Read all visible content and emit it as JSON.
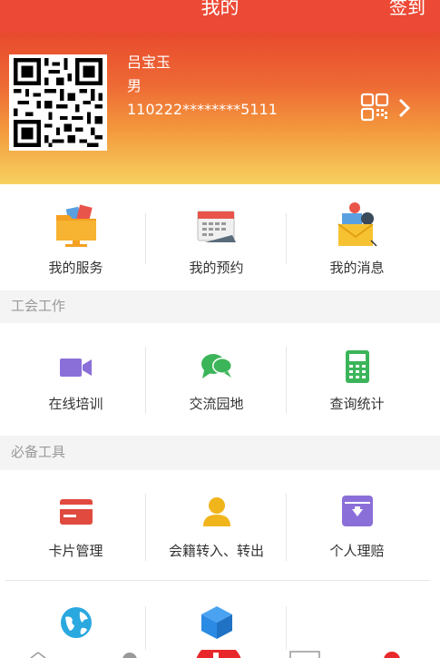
{
  "header": {
    "title": "我的",
    "action_label": "签到"
  },
  "profile": {
    "name": "吕宝玉",
    "gender": "男",
    "id_number": "110222********5111"
  },
  "quick_actions": [
    {
      "label": "我的服务",
      "icon": "folder-icon"
    },
    {
      "label": "我的预约",
      "icon": "calendar-icon"
    },
    {
      "label": "我的消息",
      "icon": "envelope-icon"
    }
  ],
  "section_union": {
    "title": "工会工作",
    "items": [
      {
        "label": "在线培训",
        "icon": "video-camera-icon",
        "color": "#8b6fd9"
      },
      {
        "label": "交流园地",
        "icon": "chat-bubbles-icon",
        "color": "#3cb55a"
      },
      {
        "label": "查询统计",
        "icon": "calculator-icon",
        "color": "#3cb55a"
      }
    ]
  },
  "section_tools": {
    "title": "必备工具",
    "items": [
      {
        "label": "卡片管理",
        "icon": "card-icon",
        "color": "#e04a3f"
      },
      {
        "label": "会籍转入、转出",
        "icon": "person-icon",
        "color": "#f1b51c"
      },
      {
        "label": "个人理赔",
        "icon": "archive-download-icon",
        "color": "#8b6fd9"
      }
    ],
    "more_items": [
      {
        "icon": "globe-icon",
        "color": "#2aa8e0"
      },
      {
        "icon": "cube-icon",
        "color": "#2b8ae3"
      }
    ]
  },
  "colors": {
    "brand": "#ec4a36",
    "divider": "#e6e6e6",
    "section_bg": "#f4f4f4"
  }
}
